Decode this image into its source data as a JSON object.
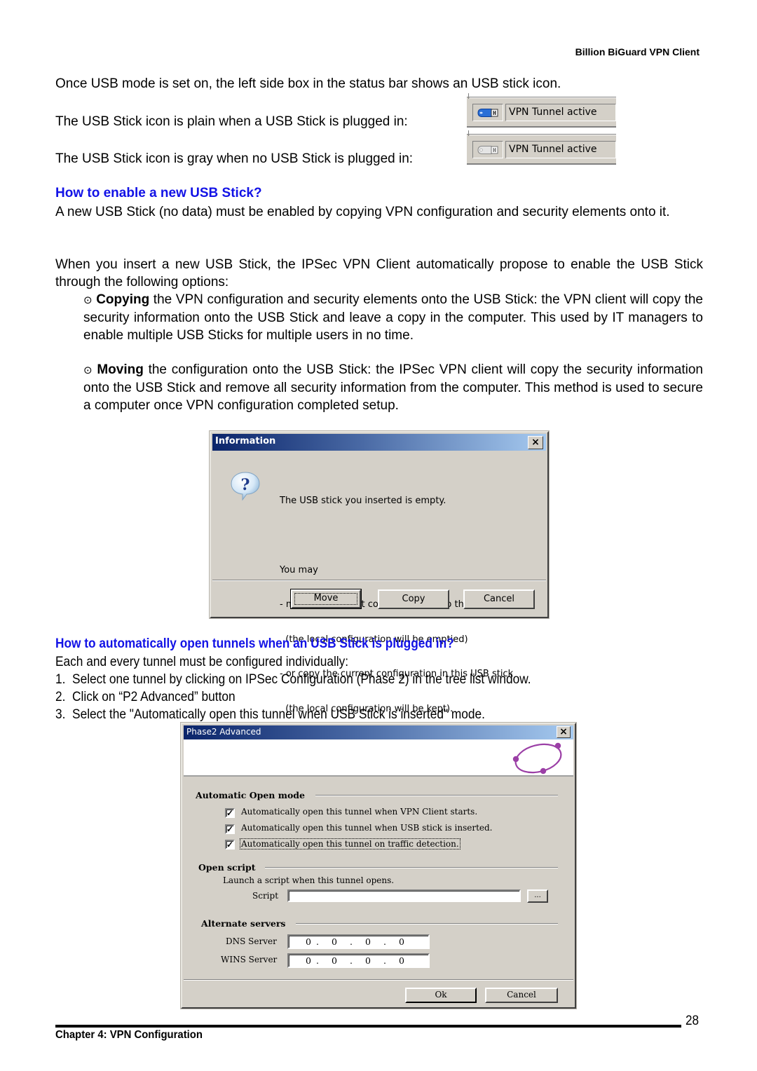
{
  "header": {
    "title": "Billion BiGuard VPN Client"
  },
  "intro": {
    "line1": "Once USB mode is set on, the left side box in the status bar shows an USB stick icon.",
    "line2": "The USB Stick icon is plain when a USB Stick is plugged in:",
    "line3": "The USB Stick icon is gray when no USB Stick is plugged in:"
  },
  "statusbars": [
    {
      "icon": "usb-stick-icon",
      "state": "plugged",
      "color": "#2a6fd6",
      "text": "VPN Tunnel active"
    },
    {
      "icon": "usb-stick-icon",
      "state": "unplugged",
      "color": "#c8c8c8",
      "text": "VPN Tunnel active"
    }
  ],
  "section1": {
    "heading": "How to enable a new USB Stick?",
    "para1": "A new USB Stick (no data) must be enabled by copying VPN configuration and security elements onto it.",
    "para2": "When you insert a new USB Stick, the IPSec VPN Client automatically propose to enable the USB Stick through the following options:",
    "bullets": [
      {
        "symbol": "⊙",
        "bold": "Copying",
        "text": " the VPN configuration and security elements onto the USB Stick: the VPN client will copy the security information onto the USB Stick and leave a copy in the computer. This used by IT managers to enable multiple USB Sticks for multiple users in no time."
      },
      {
        "symbol": "⊙",
        "bold": "Moving",
        "text": " the configuration onto the USB Stick: the IPSec VPN client will copy the security information onto the USB Stick and remove all security information from the computer. This method is used to secure a computer once VPN configuration completed setup."
      }
    ]
  },
  "info_dialog": {
    "title": "Information",
    "close": "×",
    "icon": "question-icon",
    "message_lines": [
      "The USB stick you inserted is empty.",
      "",
      "You may",
      "- move the current configuration onto the USB stick",
      "  (the local configuration will be emptied)",
      "- or copy the current configuration in this USB stick",
      "  (the local configuration will be kept)."
    ],
    "buttons": {
      "move": "Move",
      "copy": "Copy",
      "cancel": "Cancel"
    }
  },
  "section2": {
    "heading": "How to automatically open tunnels when an USB Stick is plugged in?",
    "intro": "Each and every tunnel must be configured individually:",
    "steps": [
      {
        "num": "1.",
        "text": "Select one tunnel by clicking on IPSec Configuration (Phase 2) in the tree list window."
      },
      {
        "num": "2.",
        "text": "Click on “P2 Advanced” button"
      },
      {
        "num": "3.",
        "text": "Select the \"Automatically open this tunnel when USB Stick is inserted\" mode."
      }
    ]
  },
  "p2_dialog": {
    "title": "Phase2 Advanced",
    "close": "×",
    "logo": "orbit-logo",
    "logo_color": "#9b3fa6",
    "auto_open": {
      "title": "Automatic Open mode",
      "options": [
        {
          "label": "Automatically open this tunnel when VPN Client starts.",
          "checked": true
        },
        {
          "label": "Automatically open this tunnel when USB stick is inserted.",
          "checked": true
        },
        {
          "label": "Automatically open this tunnel on traffic detection.",
          "checked": true,
          "focused": true
        }
      ]
    },
    "open_script": {
      "title": "Open script",
      "description": "Launch a script when this tunnel opens.",
      "script_label": "Script",
      "script_value": "",
      "browse": "..."
    },
    "alt_servers": {
      "title": "Alternate servers",
      "dns_label": "DNS Server",
      "dns_value": [
        "0",
        "0",
        "0",
        "0"
      ],
      "wins_label": "WINS Server",
      "wins_value": [
        "0",
        "0",
        "0",
        "0"
      ]
    },
    "buttons": {
      "ok": "Ok",
      "cancel": "Cancel"
    }
  },
  "footer": {
    "page_number": "28",
    "chapter": "Chapter 4: VPN Configuration"
  }
}
